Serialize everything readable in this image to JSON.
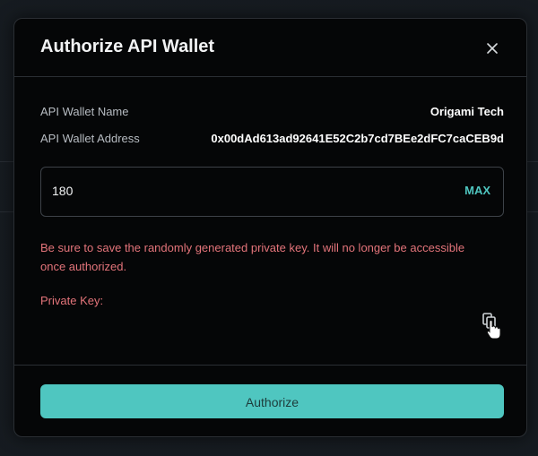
{
  "modal": {
    "title": "Authorize API Wallet",
    "close_icon": "close-icon"
  },
  "wallet": {
    "name_label": "API Wallet Name",
    "name_value": "Origami Tech",
    "address_label": "API Wallet Address",
    "address_value": "0x00dAd613ad92641E52C2b7cd7BEe2dFC7caCEB9d"
  },
  "amount": {
    "value": "180",
    "max_label": "MAX"
  },
  "warning_text": "Be sure to save the randomly generated private key. It will no longer be accessible once authorized.",
  "private_key": {
    "label": "Private Key:",
    "copy_icon": "copy-icon"
  },
  "footer": {
    "authorize_label": "Authorize"
  },
  "colors": {
    "accent": "#4fc6c0",
    "warning": "#e3747a",
    "modal_bg": "#050607",
    "border": "#2a2e33"
  }
}
